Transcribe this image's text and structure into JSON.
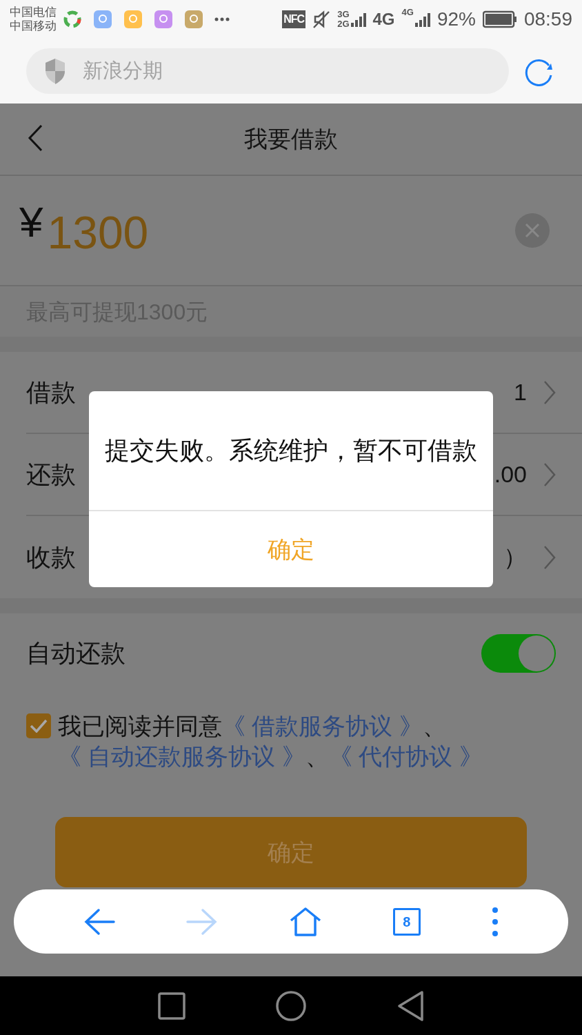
{
  "status_bar": {
    "carriers": [
      "中国电信",
      "中国移动"
    ],
    "nfc": "NFC",
    "net_1": "3G",
    "net_2": "2G",
    "net_3": "4G",
    "net_4": "4G",
    "battery": "92%",
    "time": "08:59"
  },
  "address_bar": {
    "title": "新浪分期"
  },
  "header": {
    "title": "我要借款"
  },
  "amount": {
    "currency": "¥",
    "value": "1300"
  },
  "limit_note": "最高可提现1300元",
  "rows": [
    {
      "label": "借款",
      "value": "1"
    },
    {
      "label": "还款",
      "value": ".00"
    },
    {
      "label": "收款",
      "value": "）"
    }
  ],
  "auto_repay": {
    "label": "自动还款",
    "on": true
  },
  "agreement": {
    "checked": true,
    "text": "我已阅读并同意",
    "links": [
      "《 借款服务协议 》",
      "《 自动还款服务协议 》",
      "《 代付协议 》"
    ],
    "separator": "、"
  },
  "submit_button": "确定",
  "tab_count": "8",
  "dialog": {
    "message": "提交失败。系统维护，暂不可借款",
    "button": "确定"
  }
}
